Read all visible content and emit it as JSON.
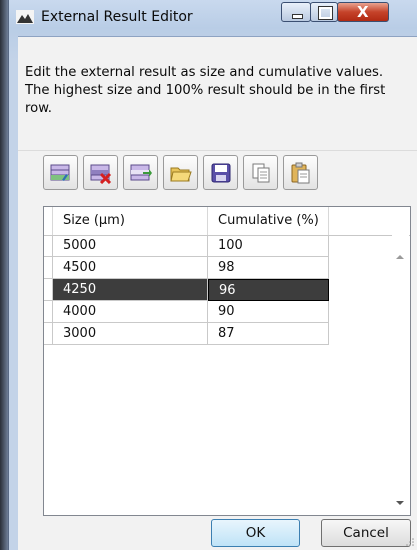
{
  "window": {
    "title": "External Result Editor",
    "close_glyph": "X"
  },
  "description": "Edit the external result as size and cumulative values. The highest size and 100% result should be in the first row.",
  "toolbar": {
    "buttons": [
      {
        "icon": "add-row-icon"
      },
      {
        "icon": "delete-row-icon"
      },
      {
        "icon": "insert-row-icon"
      },
      {
        "icon": "open-folder-icon"
      },
      {
        "icon": "save-icon"
      },
      {
        "icon": "copy-icon"
      },
      {
        "icon": "paste-icon"
      }
    ]
  },
  "grid": {
    "columns": [
      "Size (µm)",
      "Cumulative (%)"
    ],
    "rows": [
      {
        "size": "5000",
        "cumulative": "100"
      },
      {
        "size": "4500",
        "cumulative": "98"
      },
      {
        "size": "4250",
        "cumulative": "96"
      },
      {
        "size": "4000",
        "cumulative": "90"
      },
      {
        "size": "3000",
        "cumulative": "87"
      }
    ],
    "selected_row_index": 2
  },
  "buttons": {
    "ok": "OK",
    "cancel": "Cancel"
  },
  "colors": {
    "selection": "#3d3d3d",
    "close_button": "#c5432a",
    "ok_button": "#bfe3f7"
  }
}
